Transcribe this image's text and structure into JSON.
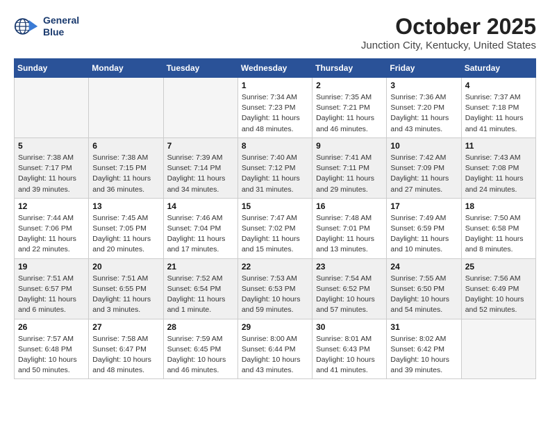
{
  "header": {
    "logo_line1": "General",
    "logo_line2": "Blue",
    "month_year": "October 2025",
    "location": "Junction City, Kentucky, United States"
  },
  "days_of_week": [
    "Sunday",
    "Monday",
    "Tuesday",
    "Wednesday",
    "Thursday",
    "Friday",
    "Saturday"
  ],
  "weeks": [
    [
      {
        "day": "",
        "info": ""
      },
      {
        "day": "",
        "info": ""
      },
      {
        "day": "",
        "info": ""
      },
      {
        "day": "1",
        "info": "Sunrise: 7:34 AM\nSunset: 7:23 PM\nDaylight: 11 hours\nand 48 minutes."
      },
      {
        "day": "2",
        "info": "Sunrise: 7:35 AM\nSunset: 7:21 PM\nDaylight: 11 hours\nand 46 minutes."
      },
      {
        "day": "3",
        "info": "Sunrise: 7:36 AM\nSunset: 7:20 PM\nDaylight: 11 hours\nand 43 minutes."
      },
      {
        "day": "4",
        "info": "Sunrise: 7:37 AM\nSunset: 7:18 PM\nDaylight: 11 hours\nand 41 minutes."
      }
    ],
    [
      {
        "day": "5",
        "info": "Sunrise: 7:38 AM\nSunset: 7:17 PM\nDaylight: 11 hours\nand 39 minutes."
      },
      {
        "day": "6",
        "info": "Sunrise: 7:38 AM\nSunset: 7:15 PM\nDaylight: 11 hours\nand 36 minutes."
      },
      {
        "day": "7",
        "info": "Sunrise: 7:39 AM\nSunset: 7:14 PM\nDaylight: 11 hours\nand 34 minutes."
      },
      {
        "day": "8",
        "info": "Sunrise: 7:40 AM\nSunset: 7:12 PM\nDaylight: 11 hours\nand 31 minutes."
      },
      {
        "day": "9",
        "info": "Sunrise: 7:41 AM\nSunset: 7:11 PM\nDaylight: 11 hours\nand 29 minutes."
      },
      {
        "day": "10",
        "info": "Sunrise: 7:42 AM\nSunset: 7:09 PM\nDaylight: 11 hours\nand 27 minutes."
      },
      {
        "day": "11",
        "info": "Sunrise: 7:43 AM\nSunset: 7:08 PM\nDaylight: 11 hours\nand 24 minutes."
      }
    ],
    [
      {
        "day": "12",
        "info": "Sunrise: 7:44 AM\nSunset: 7:06 PM\nDaylight: 11 hours\nand 22 minutes."
      },
      {
        "day": "13",
        "info": "Sunrise: 7:45 AM\nSunset: 7:05 PM\nDaylight: 11 hours\nand 20 minutes."
      },
      {
        "day": "14",
        "info": "Sunrise: 7:46 AM\nSunset: 7:04 PM\nDaylight: 11 hours\nand 17 minutes."
      },
      {
        "day": "15",
        "info": "Sunrise: 7:47 AM\nSunset: 7:02 PM\nDaylight: 11 hours\nand 15 minutes."
      },
      {
        "day": "16",
        "info": "Sunrise: 7:48 AM\nSunset: 7:01 PM\nDaylight: 11 hours\nand 13 minutes."
      },
      {
        "day": "17",
        "info": "Sunrise: 7:49 AM\nSunset: 6:59 PM\nDaylight: 11 hours\nand 10 minutes."
      },
      {
        "day": "18",
        "info": "Sunrise: 7:50 AM\nSunset: 6:58 PM\nDaylight: 11 hours\nand 8 minutes."
      }
    ],
    [
      {
        "day": "19",
        "info": "Sunrise: 7:51 AM\nSunset: 6:57 PM\nDaylight: 11 hours\nand 6 minutes."
      },
      {
        "day": "20",
        "info": "Sunrise: 7:51 AM\nSunset: 6:55 PM\nDaylight: 11 hours\nand 3 minutes."
      },
      {
        "day": "21",
        "info": "Sunrise: 7:52 AM\nSunset: 6:54 PM\nDaylight: 11 hours\nand 1 minute."
      },
      {
        "day": "22",
        "info": "Sunrise: 7:53 AM\nSunset: 6:53 PM\nDaylight: 10 hours\nand 59 minutes."
      },
      {
        "day": "23",
        "info": "Sunrise: 7:54 AM\nSunset: 6:52 PM\nDaylight: 10 hours\nand 57 minutes."
      },
      {
        "day": "24",
        "info": "Sunrise: 7:55 AM\nSunset: 6:50 PM\nDaylight: 10 hours\nand 54 minutes."
      },
      {
        "day": "25",
        "info": "Sunrise: 7:56 AM\nSunset: 6:49 PM\nDaylight: 10 hours\nand 52 minutes."
      }
    ],
    [
      {
        "day": "26",
        "info": "Sunrise: 7:57 AM\nSunset: 6:48 PM\nDaylight: 10 hours\nand 50 minutes."
      },
      {
        "day": "27",
        "info": "Sunrise: 7:58 AM\nSunset: 6:47 PM\nDaylight: 10 hours\nand 48 minutes."
      },
      {
        "day": "28",
        "info": "Sunrise: 7:59 AM\nSunset: 6:45 PM\nDaylight: 10 hours\nand 46 minutes."
      },
      {
        "day": "29",
        "info": "Sunrise: 8:00 AM\nSunset: 6:44 PM\nDaylight: 10 hours\nand 43 minutes."
      },
      {
        "day": "30",
        "info": "Sunrise: 8:01 AM\nSunset: 6:43 PM\nDaylight: 10 hours\nand 41 minutes."
      },
      {
        "day": "31",
        "info": "Sunrise: 8:02 AM\nSunset: 6:42 PM\nDaylight: 10 hours\nand 39 minutes."
      },
      {
        "day": "",
        "info": ""
      }
    ]
  ]
}
